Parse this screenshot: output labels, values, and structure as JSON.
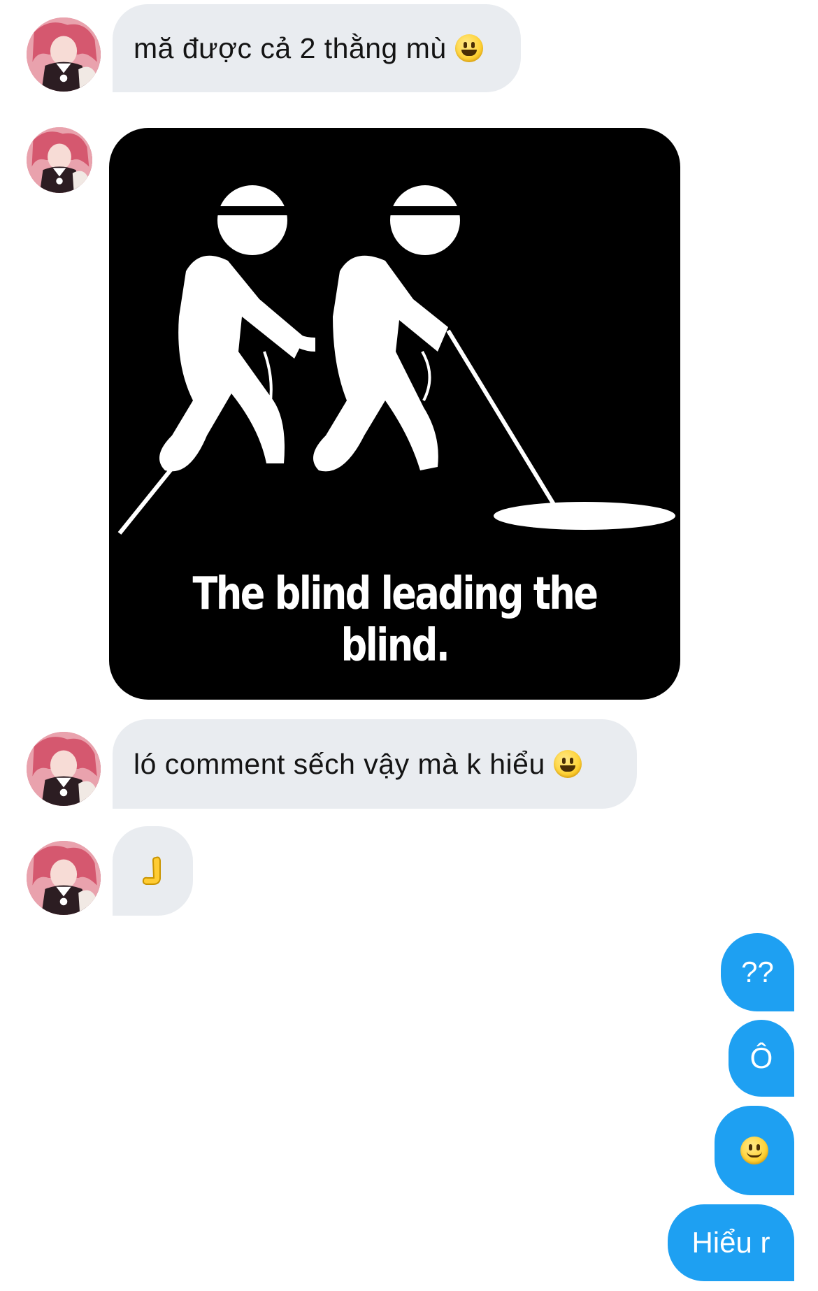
{
  "conversation": {
    "messages": [
      {
        "sender": "contact",
        "type": "text",
        "text": "mă được cả 2 thằng mù",
        "emoji": "grinning-face"
      },
      {
        "sender": "contact",
        "type": "image",
        "image_caption": "The blind leading the blind."
      },
      {
        "sender": "contact",
        "type": "text",
        "text": "ló comment sếch vậy mà k hiểu",
        "emoji": "grinning-face"
      },
      {
        "sender": "contact",
        "type": "emoji",
        "emoji": "raised-back-of-hand"
      },
      {
        "sender": "me",
        "type": "text",
        "text": "??"
      },
      {
        "sender": "me",
        "type": "text",
        "text": "Ô"
      },
      {
        "sender": "me",
        "type": "emoji",
        "emoji": "slightly-smiling-face"
      },
      {
        "sender": "me",
        "type": "text",
        "text": "Hiểu r"
      }
    ]
  },
  "colors": {
    "incoming_bubble": "#e9ecf0",
    "outgoing_bubble": "#1ea0f2",
    "image_background": "#000000"
  }
}
